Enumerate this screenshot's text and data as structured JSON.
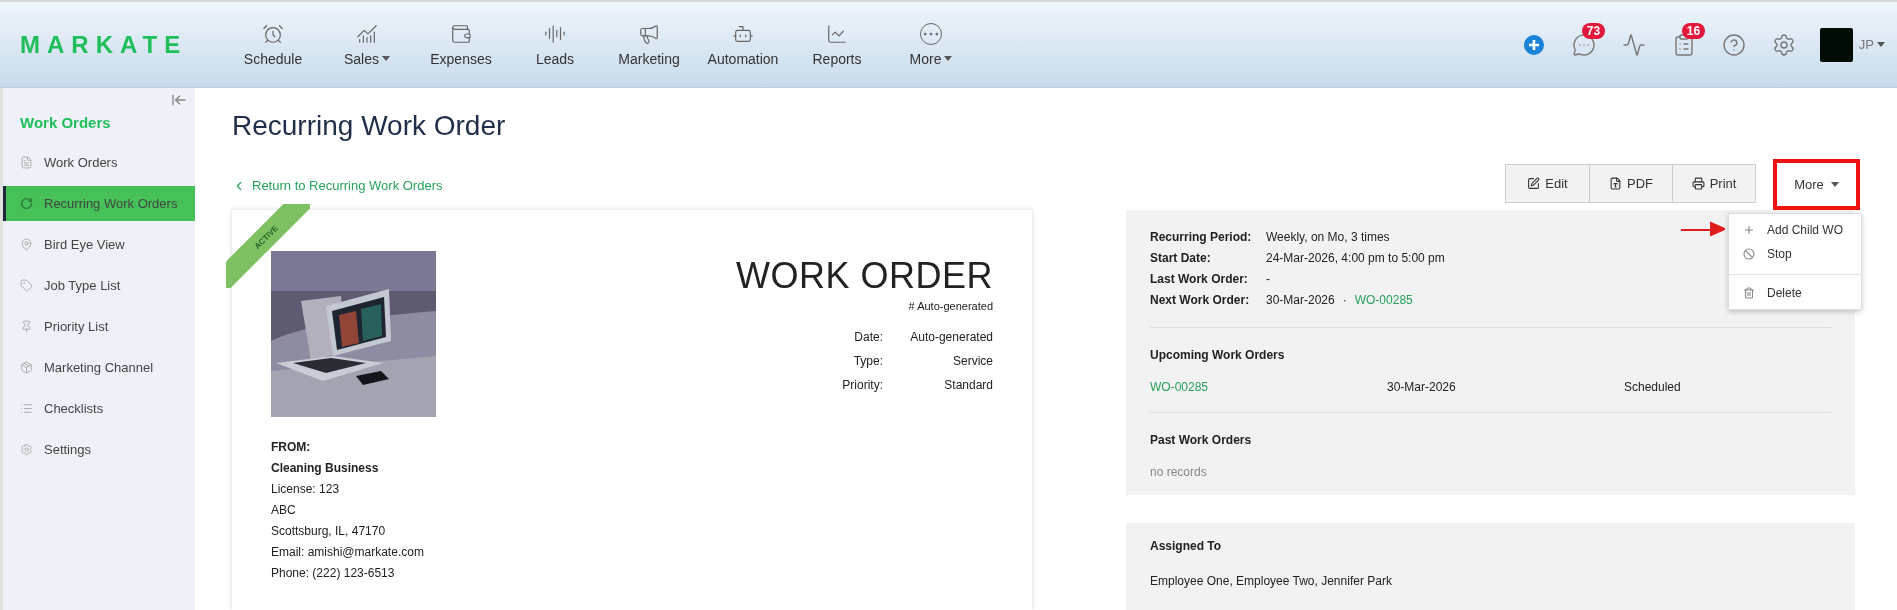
{
  "header": {
    "logo": "MARKATE",
    "nav": [
      {
        "label": "Schedule",
        "kind": "clock",
        "caret": false
      },
      {
        "label": "Sales",
        "kind": "sales",
        "caret": true
      },
      {
        "label": "Expenses",
        "kind": "wallet",
        "caret": false
      },
      {
        "label": "Leads",
        "kind": "leads",
        "caret": false
      },
      {
        "label": "Marketing",
        "kind": "megaphone",
        "caret": false
      },
      {
        "label": "Automation",
        "kind": "bot",
        "caret": false
      },
      {
        "label": "Reports",
        "kind": "chart",
        "caret": false
      },
      {
        "label": "More",
        "kind": "more",
        "caret": true
      }
    ],
    "actions": [
      {
        "kind": "add"
      },
      {
        "kind": "chat",
        "badge": "73"
      },
      {
        "kind": "activity"
      },
      {
        "kind": "tasks",
        "badge": "16"
      },
      {
        "kind": "help"
      },
      {
        "kind": "settings"
      }
    ],
    "user": "JP"
  },
  "sidebar": {
    "heading": "Work Orders",
    "items": [
      {
        "label": "Work Orders",
        "kind": "file",
        "selected": false
      },
      {
        "label": "Recurring Work Orders",
        "kind": "refresh",
        "selected": true
      },
      {
        "label": "Bird Eye View",
        "kind": "pin",
        "selected": false
      },
      {
        "label": "Job Type List",
        "kind": "tag",
        "selected": false
      },
      {
        "label": "Priority List",
        "kind": "pushpin",
        "selected": false
      },
      {
        "label": "Marketing Channel",
        "kind": "box",
        "selected": false
      },
      {
        "label": "Checklists",
        "kind": "list",
        "selected": false
      },
      {
        "label": "Settings",
        "kind": "gear",
        "selected": false
      }
    ]
  },
  "page_title": "Recurring Work Order",
  "back_link": "Return to Recurring Work Orders",
  "toolbar": [
    {
      "label": "Edit",
      "kind": "edit"
    },
    {
      "label": "PDF",
      "kind": "pdf"
    },
    {
      "label": "Print",
      "kind": "print"
    }
  ],
  "more_button": {
    "label": "More",
    "highlighted": true
  },
  "more_menu": [
    [
      {
        "label": "Add Child WO",
        "kind": "plus"
      },
      {
        "label": "Stop",
        "kind": "ban"
      }
    ],
    [
      {
        "label": "Delete",
        "kind": "trash"
      }
    ]
  ],
  "work_order": {
    "ribbon": "ACTIVE",
    "picture": {
      "kind": "picture"
    },
    "title": "WORK ORDER",
    "number": "# Auto-generated",
    "fields": [
      {
        "label": "Date:",
        "value": "Auto-generated"
      },
      {
        "label": "Type:",
        "value": "Service"
      },
      {
        "label": "Priority:",
        "value": "Standard"
      }
    ],
    "from_heading": "FROM:",
    "company": "Cleaning Business",
    "lines": [
      "License: 123",
      "ABC",
      "Scottsburg, IL, 47170",
      "Email: amishi@markate.com",
      "Phone: (222) 123-6513"
    ]
  },
  "recurrence": {
    "fields": [
      {
        "label": "Recurring Period:",
        "value": "Weekly, on Mo, 3 times"
      },
      {
        "label": "Start Date:",
        "value": "24-Mar-2026, 4:00 pm to 5:00 pm"
      },
      {
        "label": "Last Work Order:",
        "value": "-"
      },
      {
        "label": "Next Work Order:",
        "value": "30-Mar-2026",
        "separator": "·",
        "link": "WO-00285"
      }
    ],
    "upcoming_heading": "Upcoming Work Orders",
    "upcoming": [
      {
        "number": "WO-00285",
        "date": "30-Mar-2026",
        "status": "Scheduled"
      }
    ],
    "past_heading": "Past Work Orders",
    "past_empty": "no records"
  },
  "assigned": {
    "heading": "Assigned To",
    "value": "Employee One, Employee Two, Jennifer Park"
  }
}
